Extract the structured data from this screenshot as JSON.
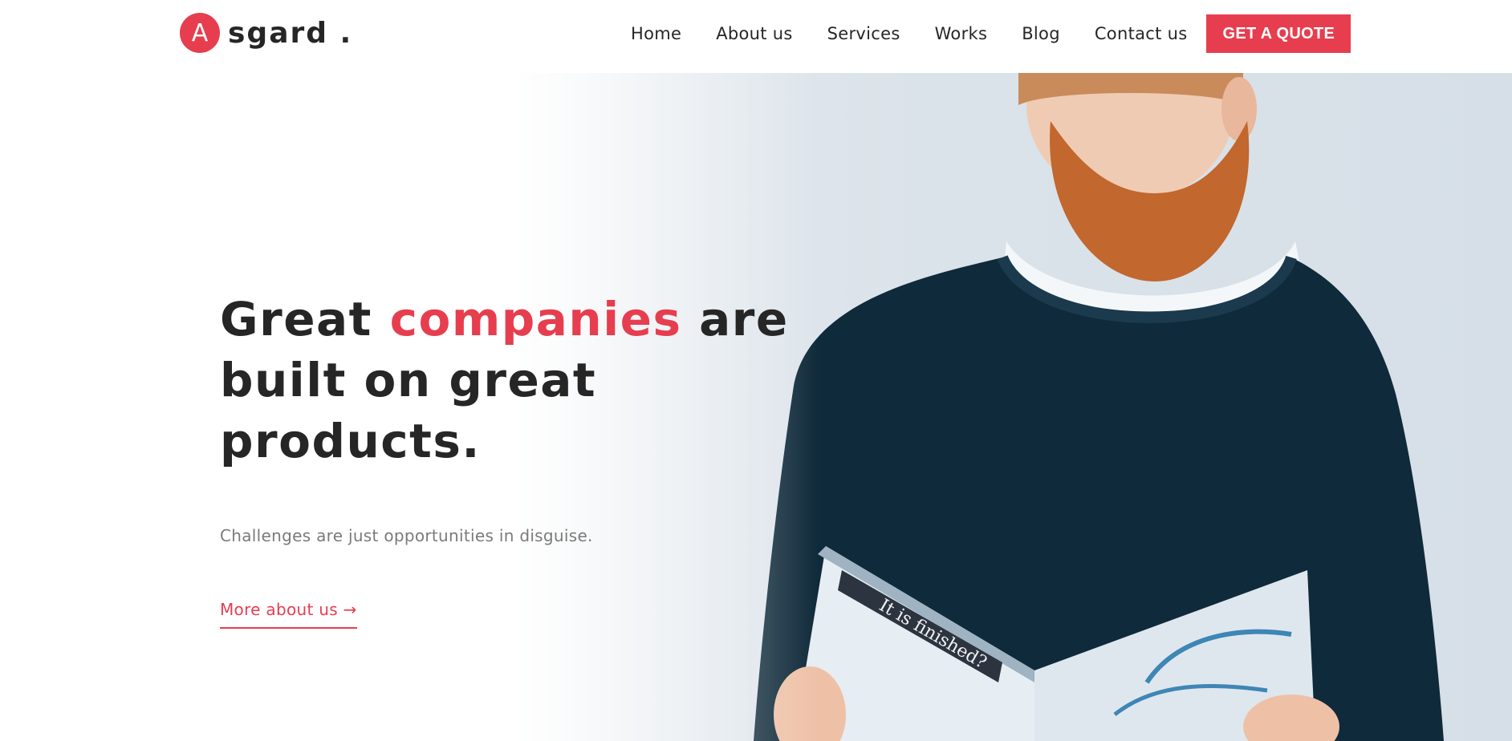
{
  "brand": {
    "mark": "A",
    "name": "sgard ."
  },
  "nav": {
    "items": [
      "Home",
      "About us",
      "Services",
      "Works",
      "Blog",
      "Contact us"
    ],
    "cta": "GET A QUOTE"
  },
  "hero": {
    "headline_before": "Great ",
    "headline_accent": "companies",
    "headline_after": " are built on great products.",
    "subtitle": "Challenges are just opportunities in disguise.",
    "link": "More about us →",
    "image_alt_text": "It is finished?"
  },
  "colors": {
    "accent": "#e63e4f",
    "text": "#262626",
    "muted": "#7a7a7a"
  }
}
